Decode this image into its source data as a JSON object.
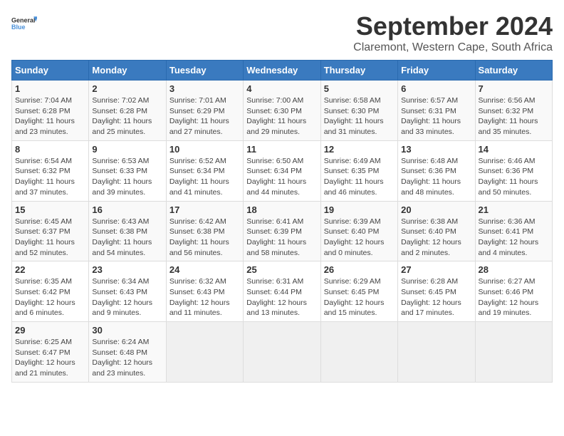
{
  "logo": {
    "general": "General",
    "blue": "Blue"
  },
  "title": "September 2024",
  "subtitle": "Claremont, Western Cape, South Africa",
  "days_of_week": [
    "Sunday",
    "Monday",
    "Tuesday",
    "Wednesday",
    "Thursday",
    "Friday",
    "Saturday"
  ],
  "weeks": [
    [
      {
        "day": "1",
        "info": "Sunrise: 7:04 AM\nSunset: 6:28 PM\nDaylight: 11 hours and 23 minutes."
      },
      {
        "day": "2",
        "info": "Sunrise: 7:02 AM\nSunset: 6:28 PM\nDaylight: 11 hours and 25 minutes."
      },
      {
        "day": "3",
        "info": "Sunrise: 7:01 AM\nSunset: 6:29 PM\nDaylight: 11 hours and 27 minutes."
      },
      {
        "day": "4",
        "info": "Sunrise: 7:00 AM\nSunset: 6:30 PM\nDaylight: 11 hours and 29 minutes."
      },
      {
        "day": "5",
        "info": "Sunrise: 6:58 AM\nSunset: 6:30 PM\nDaylight: 11 hours and 31 minutes."
      },
      {
        "day": "6",
        "info": "Sunrise: 6:57 AM\nSunset: 6:31 PM\nDaylight: 11 hours and 33 minutes."
      },
      {
        "day": "7",
        "info": "Sunrise: 6:56 AM\nSunset: 6:32 PM\nDaylight: 11 hours and 35 minutes."
      }
    ],
    [
      {
        "day": "8",
        "info": "Sunrise: 6:54 AM\nSunset: 6:32 PM\nDaylight: 11 hours and 37 minutes."
      },
      {
        "day": "9",
        "info": "Sunrise: 6:53 AM\nSunset: 6:33 PM\nDaylight: 11 hours and 39 minutes."
      },
      {
        "day": "10",
        "info": "Sunrise: 6:52 AM\nSunset: 6:34 PM\nDaylight: 11 hours and 41 minutes."
      },
      {
        "day": "11",
        "info": "Sunrise: 6:50 AM\nSunset: 6:34 PM\nDaylight: 11 hours and 44 minutes."
      },
      {
        "day": "12",
        "info": "Sunrise: 6:49 AM\nSunset: 6:35 PM\nDaylight: 11 hours and 46 minutes."
      },
      {
        "day": "13",
        "info": "Sunrise: 6:48 AM\nSunset: 6:36 PM\nDaylight: 11 hours and 48 minutes."
      },
      {
        "day": "14",
        "info": "Sunrise: 6:46 AM\nSunset: 6:36 PM\nDaylight: 11 hours and 50 minutes."
      }
    ],
    [
      {
        "day": "15",
        "info": "Sunrise: 6:45 AM\nSunset: 6:37 PM\nDaylight: 11 hours and 52 minutes."
      },
      {
        "day": "16",
        "info": "Sunrise: 6:43 AM\nSunset: 6:38 PM\nDaylight: 11 hours and 54 minutes."
      },
      {
        "day": "17",
        "info": "Sunrise: 6:42 AM\nSunset: 6:38 PM\nDaylight: 11 hours and 56 minutes."
      },
      {
        "day": "18",
        "info": "Sunrise: 6:41 AM\nSunset: 6:39 PM\nDaylight: 11 hours and 58 minutes."
      },
      {
        "day": "19",
        "info": "Sunrise: 6:39 AM\nSunset: 6:40 PM\nDaylight: 12 hours and 0 minutes."
      },
      {
        "day": "20",
        "info": "Sunrise: 6:38 AM\nSunset: 6:40 PM\nDaylight: 12 hours and 2 minutes."
      },
      {
        "day": "21",
        "info": "Sunrise: 6:36 AM\nSunset: 6:41 PM\nDaylight: 12 hours and 4 minutes."
      }
    ],
    [
      {
        "day": "22",
        "info": "Sunrise: 6:35 AM\nSunset: 6:42 PM\nDaylight: 12 hours and 6 minutes."
      },
      {
        "day": "23",
        "info": "Sunrise: 6:34 AM\nSunset: 6:43 PM\nDaylight: 12 hours and 9 minutes."
      },
      {
        "day": "24",
        "info": "Sunrise: 6:32 AM\nSunset: 6:43 PM\nDaylight: 12 hours and 11 minutes."
      },
      {
        "day": "25",
        "info": "Sunrise: 6:31 AM\nSunset: 6:44 PM\nDaylight: 12 hours and 13 minutes."
      },
      {
        "day": "26",
        "info": "Sunrise: 6:29 AM\nSunset: 6:45 PM\nDaylight: 12 hours and 15 minutes."
      },
      {
        "day": "27",
        "info": "Sunrise: 6:28 AM\nSunset: 6:45 PM\nDaylight: 12 hours and 17 minutes."
      },
      {
        "day": "28",
        "info": "Sunrise: 6:27 AM\nSunset: 6:46 PM\nDaylight: 12 hours and 19 minutes."
      }
    ],
    [
      {
        "day": "29",
        "info": "Sunrise: 6:25 AM\nSunset: 6:47 PM\nDaylight: 12 hours and 21 minutes."
      },
      {
        "day": "30",
        "info": "Sunrise: 6:24 AM\nSunset: 6:48 PM\nDaylight: 12 hours and 23 minutes."
      },
      {
        "day": "",
        "info": ""
      },
      {
        "day": "",
        "info": ""
      },
      {
        "day": "",
        "info": ""
      },
      {
        "day": "",
        "info": ""
      },
      {
        "day": "",
        "info": ""
      }
    ]
  ]
}
